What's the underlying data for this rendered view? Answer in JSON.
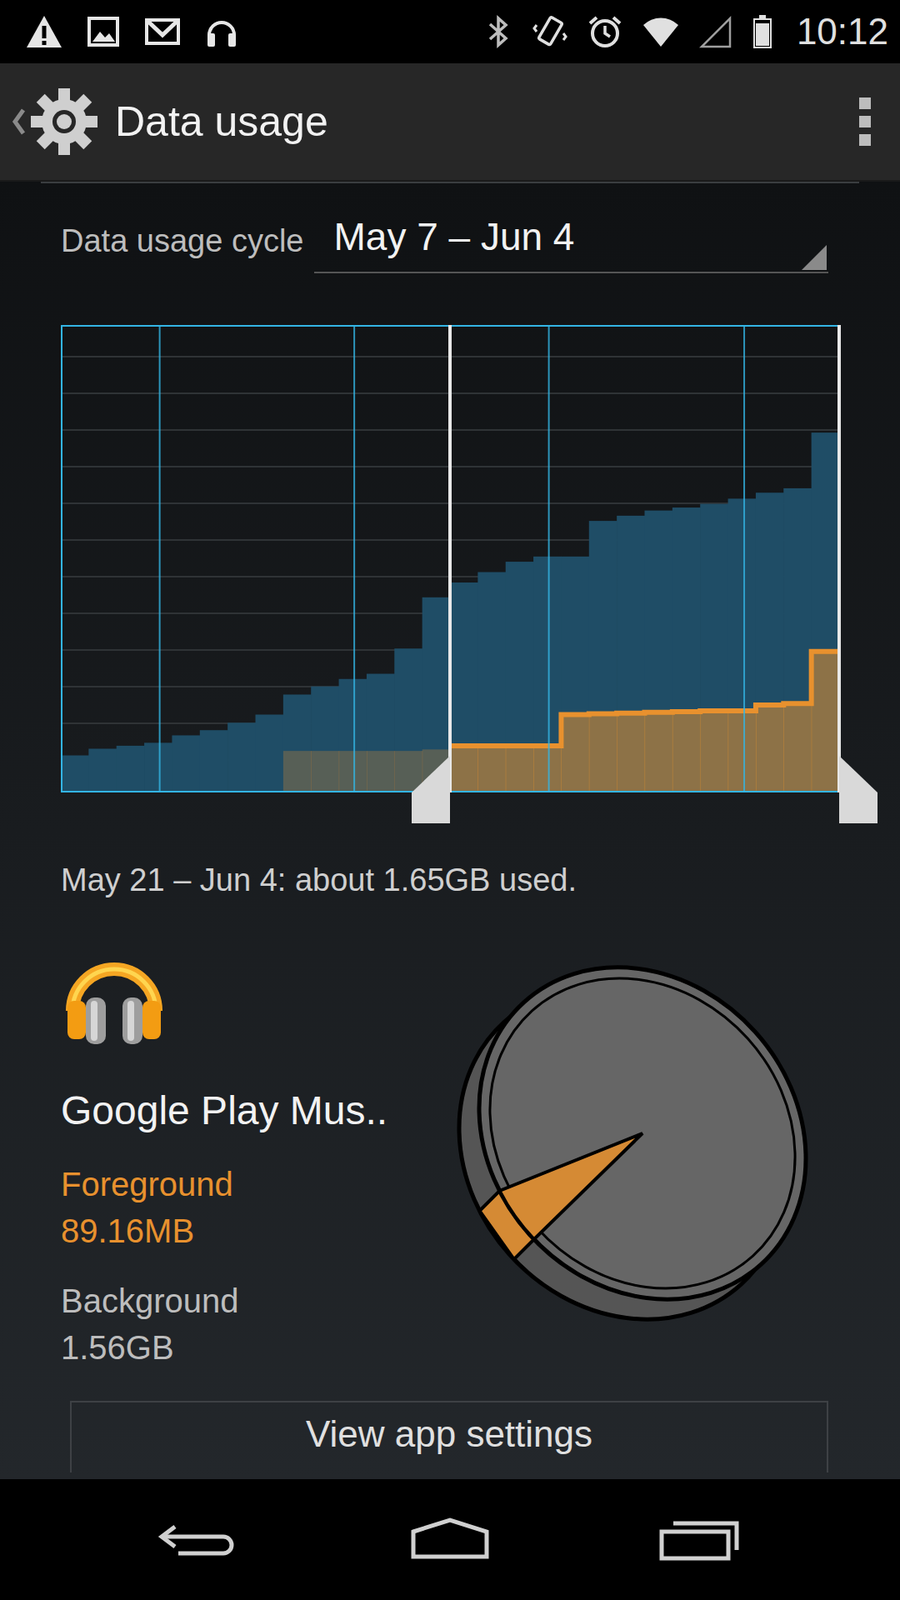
{
  "status_bar": {
    "time": "10:12",
    "battery_level": 0.9,
    "signal_level": 0
  },
  "action_bar": {
    "title": "Data usage"
  },
  "cycle": {
    "label": "Data usage cycle",
    "value": "May 7 – Jun 4"
  },
  "chart": {
    "series": [
      {
        "color": "#1f4d66",
        "values": [
          0.5,
          0.59,
          0.63,
          0.67,
          0.77,
          0.84,
          0.94,
          1.05,
          1.32,
          1.43,
          1.53,
          1.6,
          1.94,
          2.63,
          2.83,
          2.97,
          3.11,
          3.18,
          3.18,
          3.66,
          3.73,
          3.8,
          3.84,
          3.89,
          3.96,
          4.04,
          4.1,
          4.85
        ]
      },
      {
        "color": "#e8912e",
        "values": [
          0,
          0,
          0,
          0,
          0,
          0,
          0,
          0,
          0.56,
          0.56,
          0.56,
          0.56,
          0.56,
          0.58,
          0.63,
          0.63,
          0.63,
          0.63,
          1.05,
          1.06,
          1.07,
          1.08,
          1.09,
          1.1,
          1.1,
          1.18,
          1.2,
          1.9
        ]
      }
    ],
    "sweep": {
      "start_level": 0.5,
      "end_level": 1
    }
  },
  "summary": "May 21 – Jun 4: about 1.65GB used.",
  "app": {
    "name": "Google Play Mus..",
    "foreground": {
      "label": "Foreground",
      "value": "89.16MB"
    },
    "background": {
      "label": "Background",
      "value": "1.56GB"
    },
    "foreground_share": 0.054
  },
  "button": "View app settings"
}
